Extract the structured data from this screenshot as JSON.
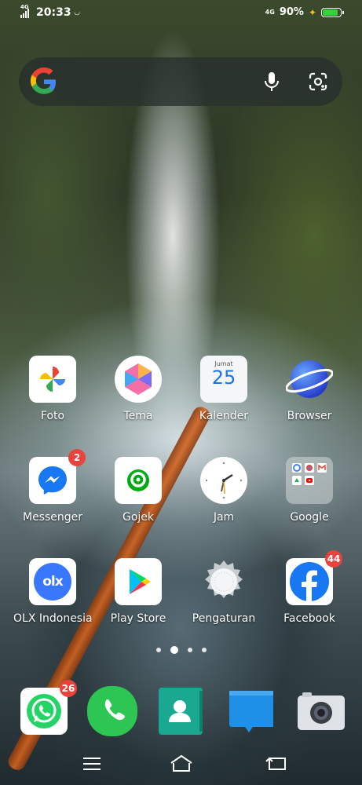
{
  "status_bar": {
    "time": "20:33",
    "network_left": "4G",
    "network_right": "4G",
    "battery_percent": "90%",
    "battery_level": 0.9,
    "battery_color": "#33d13a"
  },
  "search_bar": {
    "logo": "google-g-icon",
    "mic_icon": "microphone-icon",
    "lens_icon": "camera-lens-icon"
  },
  "apps": {
    "row1": [
      {
        "label": "Foto",
        "icon": "photos-pinwheel-icon"
      },
      {
        "label": "Tema",
        "icon": "theme-hexagon-icon"
      },
      {
        "label": "Kalender",
        "icon": "calendar-icon",
        "day_name": "Jumat",
        "day_number": "25"
      },
      {
        "label": "Browser",
        "icon": "planet-icon"
      }
    ],
    "row2": [
      {
        "label": "Messenger",
        "icon": "messenger-icon",
        "badge": "2"
      },
      {
        "label": "Gojek",
        "icon": "gojek-icon"
      },
      {
        "label": "Jam",
        "icon": "clock-icon"
      },
      {
        "label": "Google",
        "icon": "google-folder-icon"
      }
    ],
    "row3": [
      {
        "label": "OLX Indonesia",
        "icon": "olx-icon",
        "olx_text": "olx"
      },
      {
        "label": "Play Store",
        "icon": "play-store-icon"
      },
      {
        "label": "Pengaturan",
        "icon": "settings-gear-icon"
      },
      {
        "label": "Facebook",
        "icon": "facebook-icon",
        "badge": "44"
      }
    ]
  },
  "page_indicator": {
    "pages": 4,
    "current": 2
  },
  "dock": [
    {
      "name": "whatsapp",
      "icon": "whatsapp-icon",
      "badge": "26"
    },
    {
      "name": "phone",
      "icon": "phone-icon"
    },
    {
      "name": "contacts",
      "icon": "contacts-icon"
    },
    {
      "name": "messages",
      "icon": "messages-icon"
    },
    {
      "name": "camera",
      "icon": "camera-icon"
    }
  ],
  "nav_bar": {
    "menu_icon": "menu-icon",
    "home_icon": "home-icon",
    "back_icon": "back-icon"
  }
}
